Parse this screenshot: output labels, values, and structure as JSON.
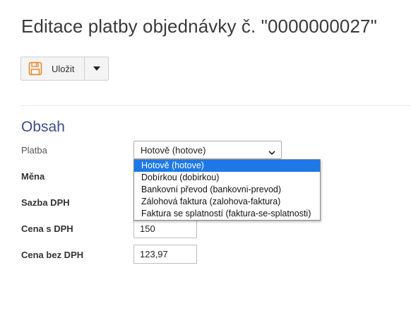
{
  "page": {
    "title": "Editace platby objednávky č. \"0000000027\""
  },
  "toolbar": {
    "save_label": "Uložit",
    "save_icon": "save-icon",
    "dropdown_icon": "caret-down-icon"
  },
  "section": {
    "title": "Obsah"
  },
  "form": {
    "platba": {
      "label": "Platba",
      "selected": "Hotově (hotove)",
      "options": [
        "Hotově (hotove)",
        "Dobírkou (dobirkou)",
        "Bankovní převod (bankovni-prevod)",
        "Zálohová faktura (zalohova-faktura)",
        "Faktura se splatností (faktura-se-splatnosti)"
      ]
    },
    "mena": {
      "label": "Měna"
    },
    "sazba_dph": {
      "label": "Sazba DPH"
    },
    "cena_s_dph": {
      "label": "Cena s DPH",
      "value": "150"
    },
    "cena_bez_dph": {
      "label": "Cena bez DPH",
      "value": "123,97"
    }
  },
  "colors": {
    "section_title": "#3e4c8a",
    "selected_option_bg": "#1e78e8",
    "save_icon": "#e8892b"
  }
}
